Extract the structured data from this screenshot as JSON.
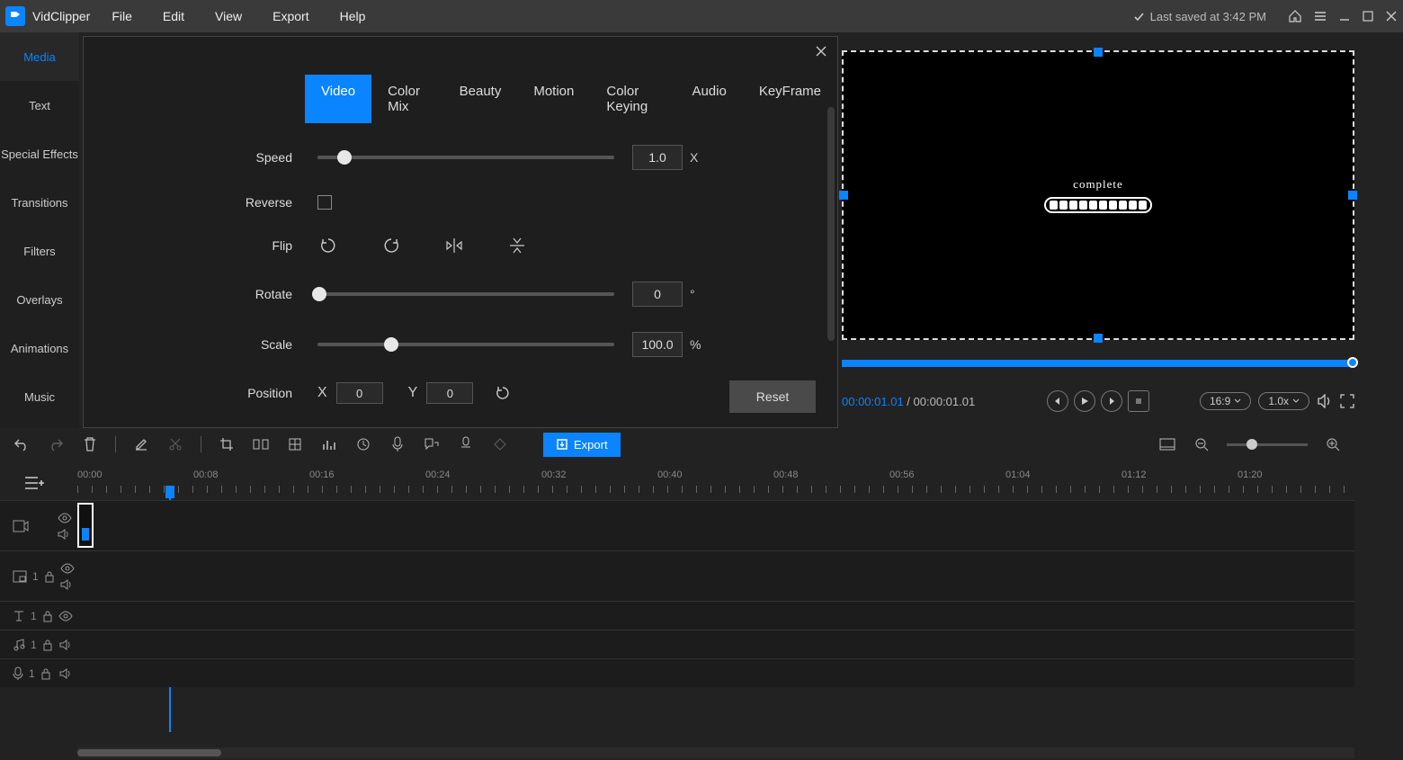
{
  "app": {
    "name": "VidClipper"
  },
  "menu": {
    "file": "File",
    "edit": "Edit",
    "view": "View",
    "export": "Export",
    "help": "Help"
  },
  "saved": "Last saved at 3:42 PM",
  "sidebar": [
    "Media",
    "Text",
    "Special Effects",
    "Transitions",
    "Filters",
    "Overlays",
    "Animations",
    "Music"
  ],
  "tabs": [
    "Video",
    "Color Mix",
    "Beauty",
    "Motion",
    "Color Keying",
    "Audio",
    "KeyFrame"
  ],
  "controls": {
    "speed": {
      "label": "Speed",
      "value": "1.0",
      "unit": "X"
    },
    "reverse": {
      "label": "Reverse"
    },
    "flip": {
      "label": "Flip"
    },
    "rotate": {
      "label": "Rotate",
      "value": "0",
      "unit": "°"
    },
    "scale": {
      "label": "Scale",
      "value": "100.0",
      "unit": "%"
    },
    "position": {
      "label": "Position",
      "xlabel": "X",
      "x": "0",
      "ylabel": "Y",
      "y": "0"
    },
    "reset": "Reset"
  },
  "preview": {
    "clip_label": "complete",
    "time_current": "00:00:01.01",
    "time_sep": " / ",
    "time_total": "00:00:01.01",
    "aspect": "16:9",
    "rate": "1.0x"
  },
  "toolbar_export": "Export",
  "ruler": [
    "00:00",
    "00:08",
    "00:16",
    "00:24",
    "00:32",
    "00:40",
    "00:48",
    "00:56",
    "01:04",
    "01:12",
    "01:20"
  ],
  "tracks": {
    "t2": {
      "num": "1"
    },
    "t3": {
      "num": "1"
    },
    "t4": {
      "num": "1"
    },
    "t5": {
      "num": "1"
    }
  }
}
